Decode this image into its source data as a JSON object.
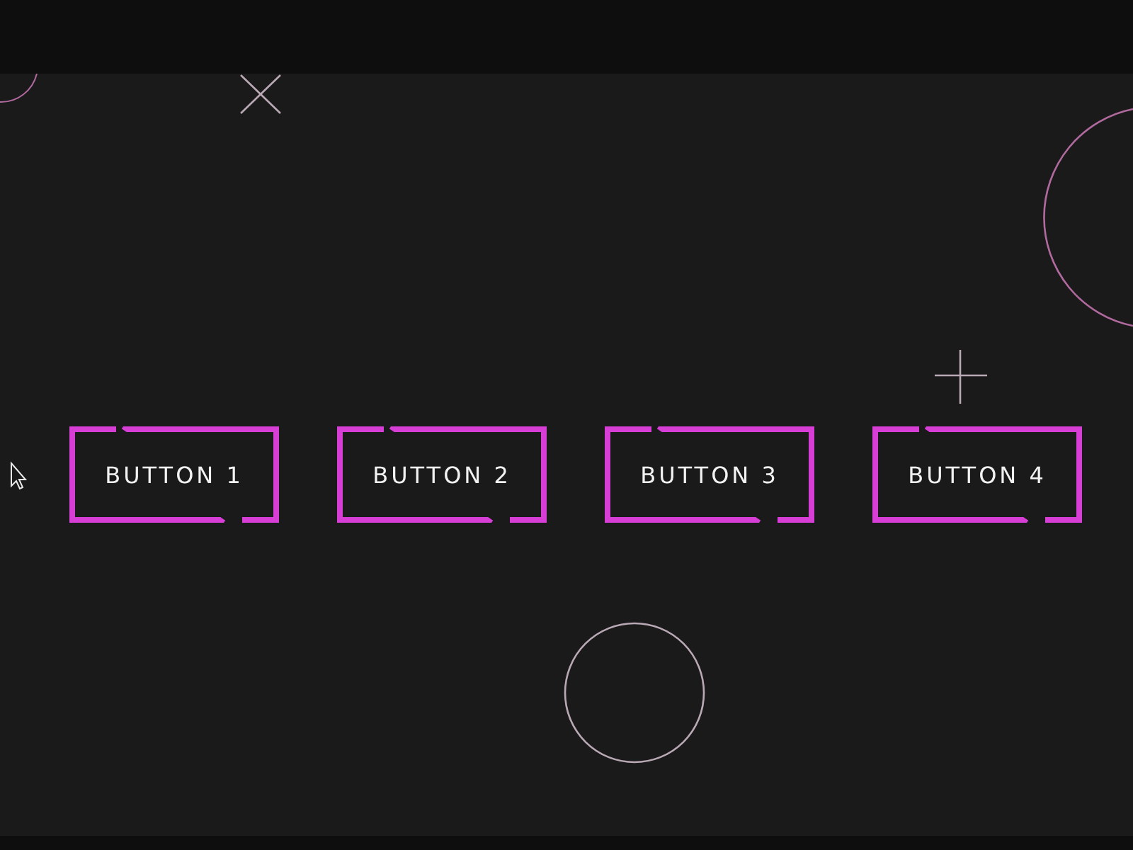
{
  "buttons": [
    {
      "label": "BUTTON 1"
    },
    {
      "label": "BUTTON 2"
    },
    {
      "label": "BUTTON 3"
    },
    {
      "label": "BUTTON 4"
    }
  ]
}
